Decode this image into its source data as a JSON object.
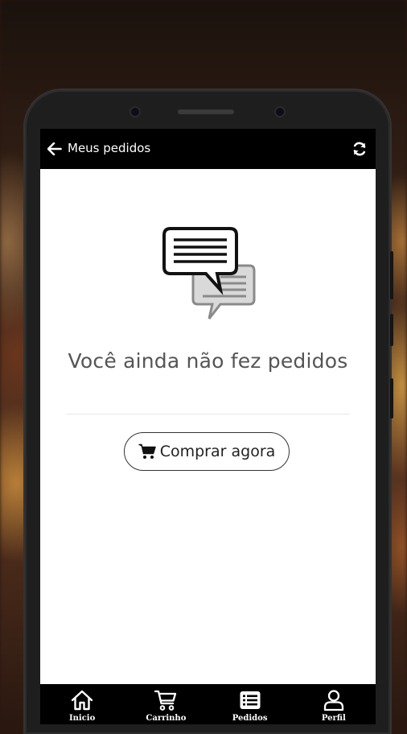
{
  "appbar": {
    "title": "Meus pedidos",
    "back_icon": "arrow-left-icon",
    "refresh_icon": "refresh-icon"
  },
  "empty_state": {
    "icon": "chat-bubbles-icon",
    "message": "Você ainda não fez pedidos"
  },
  "buy_button": {
    "label": "Comprar agora",
    "icon": "shopping-cart-icon"
  },
  "bottom_nav": {
    "items": [
      {
        "label": "Inicio",
        "icon": "home-icon"
      },
      {
        "label": "Carrinho",
        "icon": "shopping-cart-icon"
      },
      {
        "label": "Pedidos",
        "icon": "list-icon"
      },
      {
        "label": "Perfil",
        "icon": "user-icon"
      }
    ]
  },
  "colors": {
    "bar_background": "#000000",
    "screen_background": "#ffffff",
    "message_text": "#555555"
  }
}
